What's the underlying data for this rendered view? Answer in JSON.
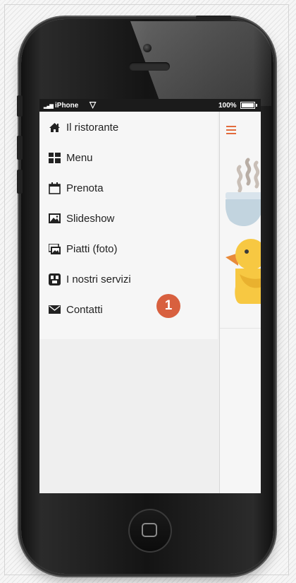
{
  "status_bar": {
    "signal": "▂▄▆",
    "carrier": "iPhone",
    "wifi": "▽",
    "battery_pct": "100%"
  },
  "menu": {
    "items": [
      {
        "label": "Il ristorante",
        "icon": "home-icon"
      },
      {
        "label": "Menu",
        "icon": "grid-icon"
      },
      {
        "label": "Prenota",
        "icon": "calendar-icon"
      },
      {
        "label": "Slideshow",
        "icon": "image-icon"
      },
      {
        "label": "Piatti (foto)",
        "icon": "photos-icon"
      },
      {
        "label": "I nostri servizi",
        "icon": "services-icon"
      },
      {
        "label": "Contatti",
        "icon": "envelope-icon"
      }
    ]
  },
  "annotation": {
    "badge": "1",
    "color": "#d8603f"
  },
  "colors": {
    "accent": "#e26b3c"
  }
}
